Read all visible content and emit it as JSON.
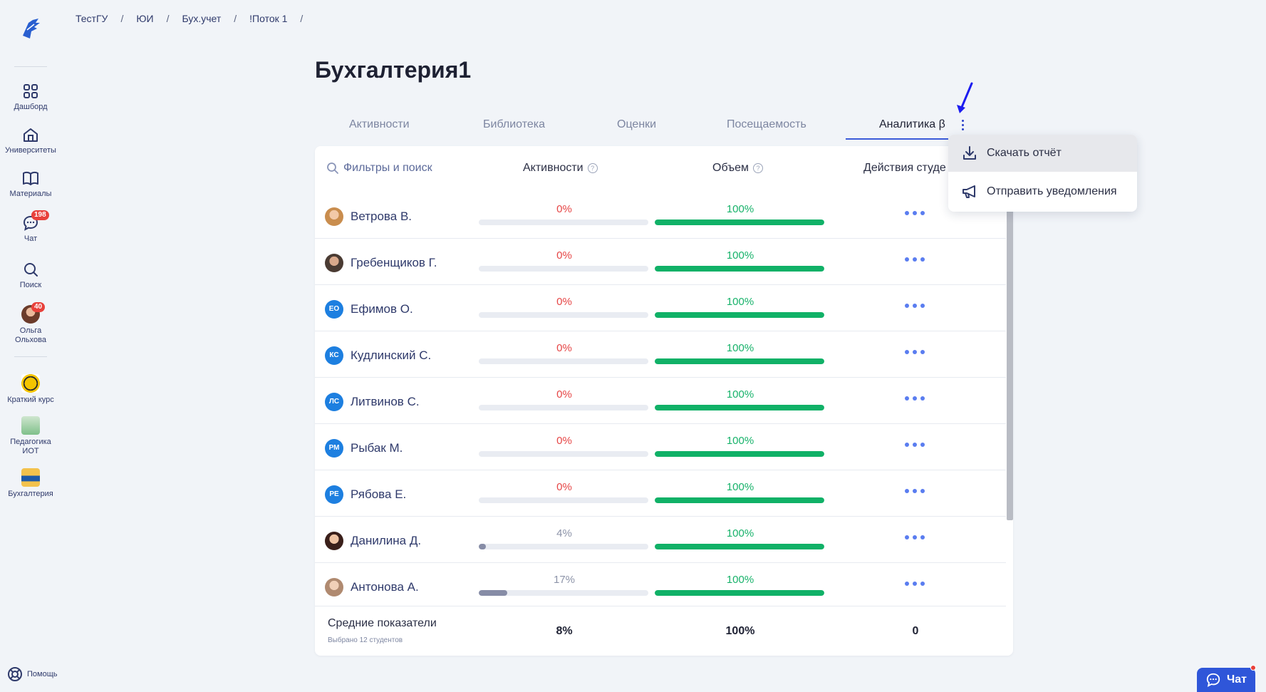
{
  "breadcrumb": [
    "ТестГУ",
    "ЮИ",
    "Бух.учет",
    "!Поток 1"
  ],
  "page_title": "Бухгалтерия1",
  "sidebar": {
    "items": [
      {
        "label": "Дашборд",
        "icon": "grid-icon"
      },
      {
        "label": "Университеты",
        "icon": "university-icon"
      },
      {
        "label": "Материалы",
        "icon": "book-icon"
      },
      {
        "label": "Чат",
        "icon": "chat-icon",
        "badge": "198"
      },
      {
        "label": "Поиск",
        "icon": "search-icon"
      },
      {
        "label": "Ольга Ольхова",
        "icon": "avatar",
        "badge": "40"
      }
    ],
    "courses": [
      {
        "label": "Краткий курс"
      },
      {
        "label": "Педагогика ИОТ"
      },
      {
        "label": "Бухгалтерия"
      }
    ],
    "help": "Помощь"
  },
  "tabs": [
    "Активности",
    "Библиотека",
    "Оценки",
    "Посещаемость",
    "Аналитика β"
  ],
  "table": {
    "search_label": "Фильтры и поиск",
    "col_activity": "Активности",
    "col_volume": "Объем",
    "col_actions": "Действия студе",
    "rows": [
      {
        "name": "Ветрова В.",
        "initials": "",
        "activity": "0%",
        "activity_value": 0,
        "volume": "100%",
        "volume_value": 100
      },
      {
        "name": "Гребенщиков Г.",
        "initials": "",
        "activity": "0%",
        "activity_value": 0,
        "volume": "100%",
        "volume_value": 100
      },
      {
        "name": "Ефимов О.",
        "initials": "ЕО",
        "activity": "0%",
        "activity_value": 0,
        "volume": "100%",
        "volume_value": 100
      },
      {
        "name": "Кудлинский С.",
        "initials": "КС",
        "activity": "0%",
        "activity_value": 0,
        "volume": "100%",
        "volume_value": 100
      },
      {
        "name": "Литвинов С.",
        "initials": "ЛС",
        "activity": "0%",
        "activity_value": 0,
        "volume": "100%",
        "volume_value": 100
      },
      {
        "name": "Рыбак М.",
        "initials": "РМ",
        "activity": "0%",
        "activity_value": 0,
        "volume": "100%",
        "volume_value": 100
      },
      {
        "name": "Рябова Е.",
        "initials": "РЕ",
        "activity": "0%",
        "activity_value": 0,
        "volume": "100%",
        "volume_value": 100
      },
      {
        "name": "Данилина Д.",
        "initials": "",
        "activity": "4%",
        "activity_value": 4,
        "volume": "100%",
        "volume_value": 100
      },
      {
        "name": "Антонова А.",
        "initials": "",
        "activity": "17%",
        "activity_value": 17,
        "volume": "100%",
        "volume_value": 100
      }
    ],
    "footer": {
      "title": "Средние показатели",
      "subtitle": "Выбрано 12 студентов",
      "activity": "8%",
      "volume": "100%",
      "actions": "0"
    }
  },
  "menu": {
    "download": "Скачать отчёт",
    "notify": "Отправить уведомления"
  },
  "chat_widget": "Чат",
  "colors": {
    "accent": "#3b5bd9",
    "green": "#10b167",
    "red": "#e64545",
    "badge": "#e8413b"
  }
}
